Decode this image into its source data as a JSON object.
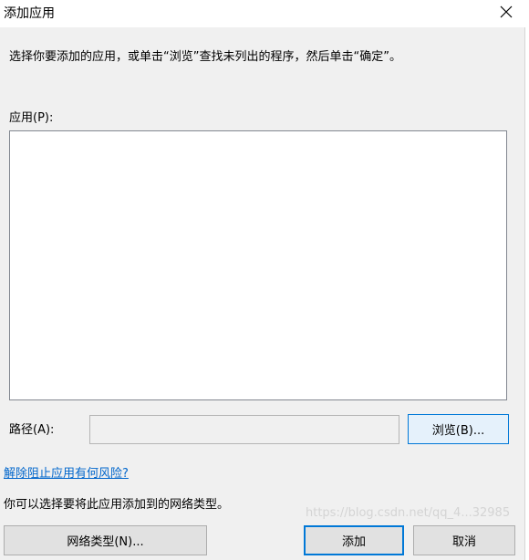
{
  "window": {
    "title": "添加应用"
  },
  "description": "选择你要添加的应用，或单击“浏览”查找未列出的程序，然后单击“确定”。",
  "apps": {
    "label": "应用(P):"
  },
  "path": {
    "label": "路径(A):",
    "value": "",
    "browse_label": "浏览(B)..."
  },
  "risk_link": "解除阻止应用有何风险?",
  "network": {
    "text": "你可以选择要将此应用添加到的网络类型。",
    "button_label": "网络类型(N)..."
  },
  "buttons": {
    "add": "添加",
    "cancel": "取消"
  },
  "watermark": "https://blog.csdn.net/qq_4...32985",
  "colors": {
    "accent": "#0078d7",
    "link": "#0066cc",
    "dialog_bg": "#f0f0f0"
  }
}
